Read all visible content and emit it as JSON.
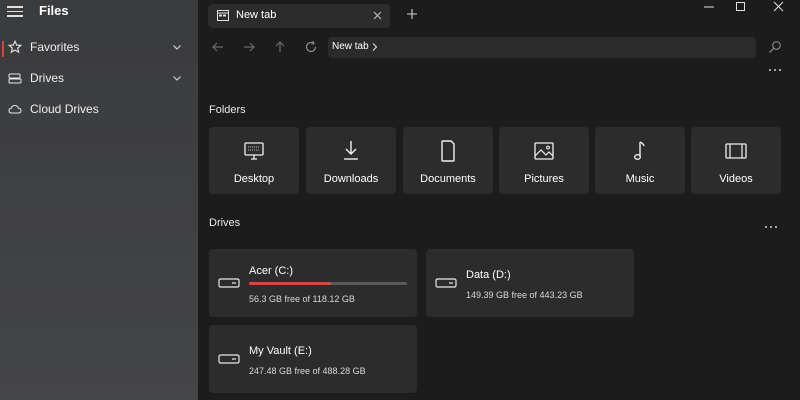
{
  "app": {
    "title": "Files"
  },
  "sidebar": {
    "items": [
      {
        "label": "Favorites",
        "icon": "star-icon",
        "expandable": true,
        "active": true
      },
      {
        "label": "Drives",
        "icon": "drive-icon",
        "expandable": true,
        "active": false
      },
      {
        "label": "Cloud Drives",
        "icon": "cloud-icon",
        "expandable": false,
        "active": false
      }
    ]
  },
  "tabs": [
    {
      "label": "New tab",
      "icon": "tab-page-icon"
    }
  ],
  "addressbar": {
    "crumb": "New tab"
  },
  "folders": {
    "title": "Folders",
    "items": [
      {
        "label": "Desktop",
        "icon": "desktop-icon"
      },
      {
        "label": "Downloads",
        "icon": "download-icon"
      },
      {
        "label": "Documents",
        "icon": "document-icon"
      },
      {
        "label": "Pictures",
        "icon": "picture-icon"
      },
      {
        "label": "Music",
        "icon": "music-icon"
      },
      {
        "label": "Videos",
        "icon": "video-icon"
      }
    ]
  },
  "drives": {
    "title": "Drives",
    "items": [
      {
        "name": "Acer (C:)",
        "free": "56.3 GB free of 118.12 GB",
        "used_fraction": 0.52,
        "show_bar": true
      },
      {
        "name": "Data (D:)",
        "free": "149.39 GB free of 443.23 GB",
        "used_fraction": 0.66,
        "show_bar": false
      },
      {
        "name": "My Vault (E:)",
        "free": "247.48 GB free of 488.28 GB",
        "used_fraction": 0.49,
        "show_bar": false
      }
    ]
  },
  "colors": {
    "accent": "#d24a3a",
    "sidebar_bg": "#3f4042",
    "main_bg": "#1c1c1c",
    "card_bg": "#2c2c2c"
  }
}
